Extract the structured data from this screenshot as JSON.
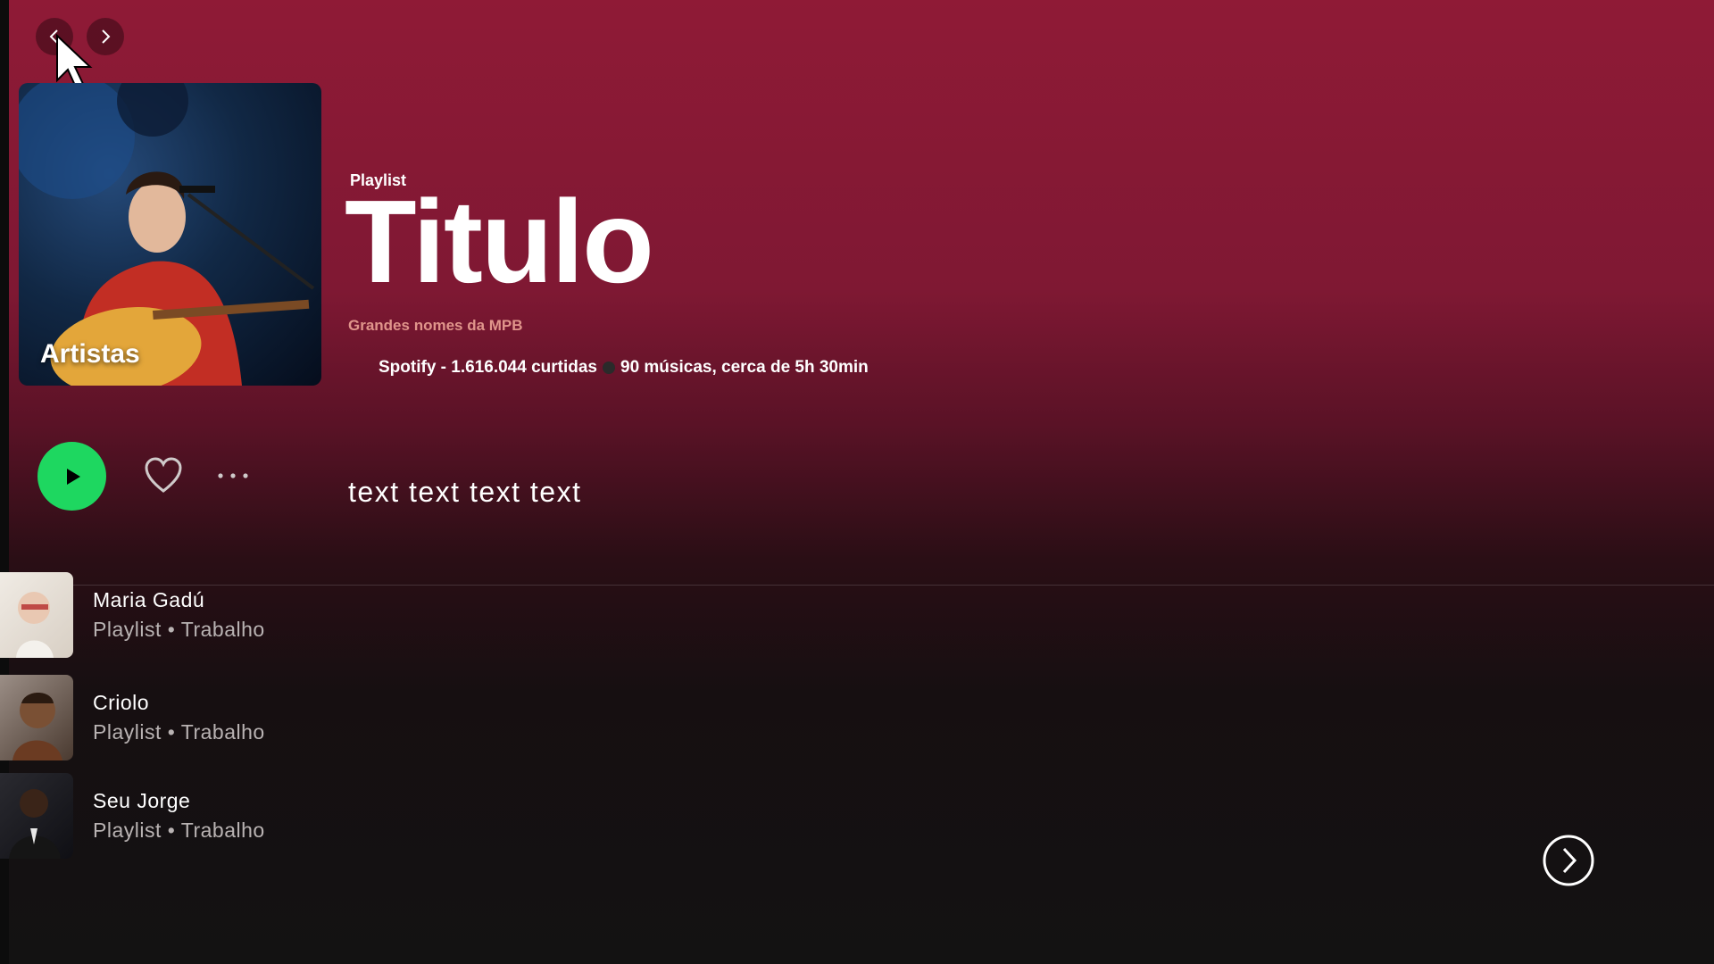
{
  "header": {
    "type_label": "Playlist",
    "title": "Titulo",
    "subtitle": "Grandes nomes da MPB",
    "meta_owner": "Spotify - 1.616.044 curtidas",
    "meta_details": "90 músicas, cerca de 5h 30min"
  },
  "cover": {
    "label": "Artistas"
  },
  "controls": {
    "description": "text text text text"
  },
  "tracks": [
    {
      "name": "Maria Gadú",
      "sub": "Playlist • Trabalho"
    },
    {
      "name": "Criolo",
      "sub": "Playlist • Trabalho"
    },
    {
      "name": "Seu Jorge",
      "sub": "Playlist • Trabalho"
    }
  ],
  "icons": {
    "back": "chevron-left-icon",
    "forward": "chevron-right-icon",
    "play": "play-icon",
    "like": "heart-icon",
    "more": "more-horizontal-icon",
    "next": "chevron-right-circle-icon"
  },
  "colors": {
    "accent": "#1ed760",
    "header_bg": "#8f1a36",
    "subtitle": "#e0958b"
  }
}
